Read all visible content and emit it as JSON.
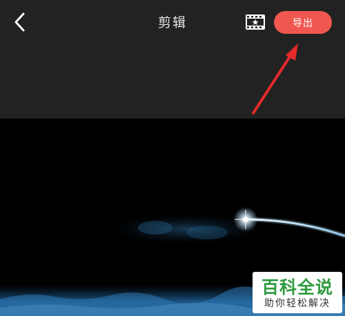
{
  "header": {
    "title": "剪辑",
    "back_icon": "chevron-left-icon",
    "film_icon": "film-star-icon",
    "export_label": "导出",
    "export_color": "#f0584f",
    "background": "#222222"
  },
  "annotation": {
    "arrow_color": "#e52a2a"
  },
  "preview": {
    "background": "#000000",
    "content": "shooting-star-video-frame"
  },
  "watermark": {
    "title": "百科全说",
    "subtitle": "助你轻松解决"
  }
}
